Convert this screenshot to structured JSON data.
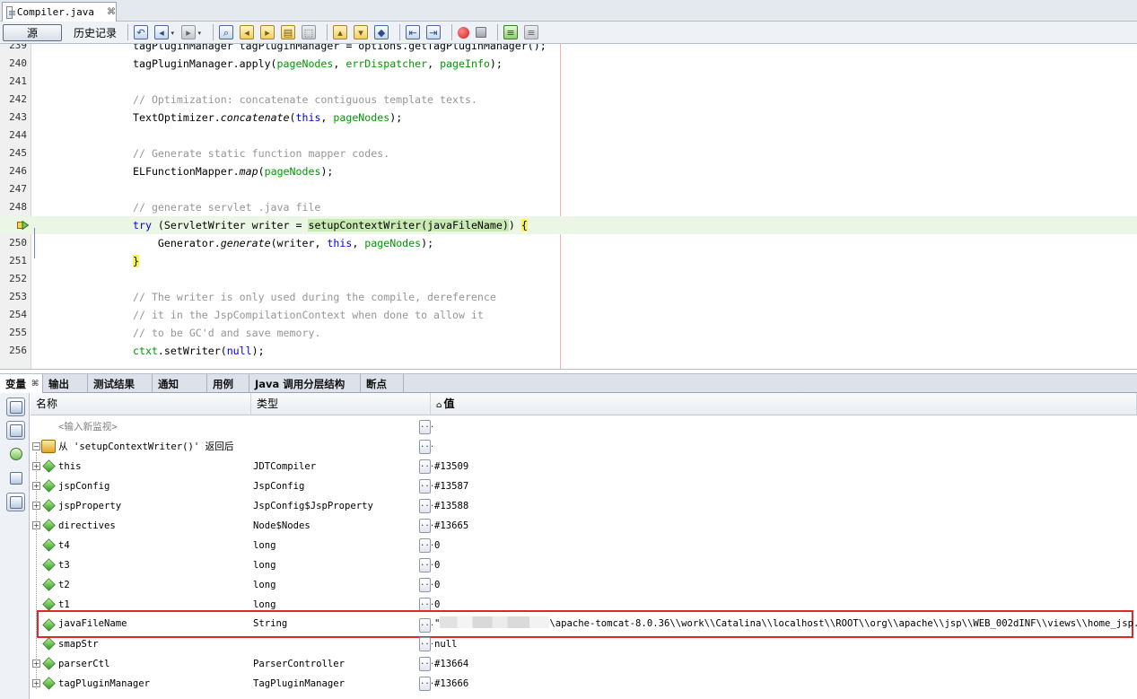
{
  "editor_tab": {
    "filename": "Compiler.java",
    "close_glyph": "⌘"
  },
  "toolbar": {
    "source_label": "源",
    "history_label": "历史记录",
    "icons": [
      "last-edit-icon",
      "back-icon",
      "forward-icon",
      "find-selection-icon",
      "find-previous-icon",
      "find-next-icon",
      "toggle-highlight-icon",
      "toggle-rect-selection-icon",
      "previous-bookmark-icon",
      "next-bookmark-icon",
      "toggle-bookmark-icon",
      "shift-left-icon",
      "shift-right-icon",
      "start-macro-icon",
      "stop-macro-icon",
      "comment-icon",
      "uncomment-icon"
    ]
  },
  "code": {
    "lines": [
      {
        "n": "239",
        "parts": [
          [
            "",
            "tagPluginManager tagPluginManager = options.getTagPluginManager();"
          ]
        ]
      },
      {
        "n": "240",
        "parts": [
          [
            "",
            "tagPluginManager.apply("
          ],
          [
            "fld",
            "pageNodes"
          ],
          [
            "",
            ", "
          ],
          [
            "fld",
            "errDispatcher"
          ],
          [
            "",
            ", "
          ],
          [
            "fld",
            "pageInfo"
          ],
          [
            "",
            ");"
          ]
        ]
      },
      {
        "n": "241",
        "parts": []
      },
      {
        "n": "242",
        "parts": [
          [
            "cm",
            "// Optimization: concatenate contiguous template texts."
          ]
        ]
      },
      {
        "n": "243",
        "parts": [
          [
            "",
            "TextOptimizer."
          ],
          [
            "it",
            "concatenate"
          ],
          [
            "",
            "("
          ],
          [
            "kw",
            "this"
          ],
          [
            "",
            ", "
          ],
          [
            "fld",
            "pageNodes"
          ],
          [
            "",
            ");"
          ]
        ]
      },
      {
        "n": "244",
        "parts": []
      },
      {
        "n": "245",
        "parts": [
          [
            "cm",
            "// Generate static function mapper codes."
          ]
        ]
      },
      {
        "n": "246",
        "parts": [
          [
            "",
            "ELFunctionMapper."
          ],
          [
            "it",
            "map"
          ],
          [
            "",
            "("
          ],
          [
            "fld",
            "pageNodes"
          ],
          [
            "",
            ");"
          ]
        ]
      },
      {
        "n": "247",
        "parts": []
      },
      {
        "n": "248",
        "parts": [
          [
            "cm",
            "// generate servlet .java file"
          ]
        ]
      },
      {
        "n": "",
        "parts": [
          [
            "kw",
            "try"
          ],
          [
            "",
            " (ServletWriter writer = "
          ],
          [
            "ret-bg",
            "setupContextWriter(javaFileName)"
          ],
          [
            "",
            ") "
          ],
          [
            "brace-y",
            "{"
          ]
        ],
        "highlight": true,
        "pc": true
      },
      {
        "n": "250",
        "parts": [
          [
            "",
            "    Generator."
          ],
          [
            "it",
            "generate"
          ],
          [
            "",
            "(writer, "
          ],
          [
            "kw",
            "this"
          ],
          [
            "",
            ", "
          ],
          [
            "fld",
            "pageNodes"
          ],
          [
            "",
            ");"
          ]
        ]
      },
      {
        "n": "251",
        "parts": [
          [
            "brace-y",
            "}"
          ]
        ]
      },
      {
        "n": "252",
        "parts": []
      },
      {
        "n": "253",
        "parts": [
          [
            "cm",
            "// The writer is only used during the compile, dereference"
          ]
        ]
      },
      {
        "n": "254",
        "parts": [
          [
            "cm",
            "// it in the JspCompilationContext when done to allow it"
          ]
        ]
      },
      {
        "n": "255",
        "parts": [
          [
            "cm",
            "// to be GC'd and save memory."
          ]
        ]
      },
      {
        "n": "256",
        "parts": [
          [
            "fld",
            "ctxt"
          ],
          [
            "",
            ".setWriter("
          ],
          [
            "kw",
            "null"
          ],
          [
            "",
            ");"
          ]
        ]
      }
    ]
  },
  "panel_tabs": [
    {
      "label": "变量",
      "active": true,
      "close": "⌘"
    },
    {
      "label": "输出"
    },
    {
      "label": "测试结果"
    },
    {
      "label": "通知"
    },
    {
      "label": "用例"
    },
    {
      "label": "Java 调用分层结构"
    },
    {
      "label": "断点"
    }
  ],
  "variables": {
    "columns": {
      "name": "名称",
      "type": "类型",
      "value": "值",
      "sort_glyph": "⌂"
    },
    "placeholder": "<输入新监视>",
    "return_node": "从 'setupContextWriter()' 返回后",
    "rows": [
      {
        "name": "this",
        "type": "JDTCompiler",
        "value": "#13509",
        "expandable": true
      },
      {
        "name": "jspConfig",
        "type": "JspConfig",
        "value": "#13587",
        "expandable": true
      },
      {
        "name": "jspProperty",
        "type": "JspConfig$JspProperty",
        "value": "#13588",
        "expandable": true
      },
      {
        "name": "directives",
        "type": "Node$Nodes",
        "value": "#13665",
        "expandable": true
      },
      {
        "name": "t4",
        "type": "long",
        "value": "0"
      },
      {
        "name": "t3",
        "type": "long",
        "value": "0"
      },
      {
        "name": "t2",
        "type": "long",
        "value": "0"
      },
      {
        "name": "t1",
        "type": "long",
        "value": "0"
      },
      {
        "name": "javaFileName",
        "type": "String",
        "value_prefix": "\"",
        "value": "\\apache-tomcat-8.0.36\\\\work\\\\Catalina\\\\localhost\\\\ROOT\\\\org\\\\apache\\\\jsp\\\\WEB_002dINF\\\\views\\\\home_jsp.java\"",
        "selected": true
      },
      {
        "name": "smapStr",
        "type": "",
        "value": "null"
      },
      {
        "name": "parserCtl",
        "type": "ParserController",
        "value": "#13664",
        "expandable": true
      },
      {
        "name": "tagPluginManager",
        "type": "TagPluginManager",
        "value": "#13666",
        "expandable": true
      }
    ]
  },
  "glyphs": {
    "expand": "+",
    "collapse": "−",
    "dots": "...",
    "dropdown": "▾"
  }
}
